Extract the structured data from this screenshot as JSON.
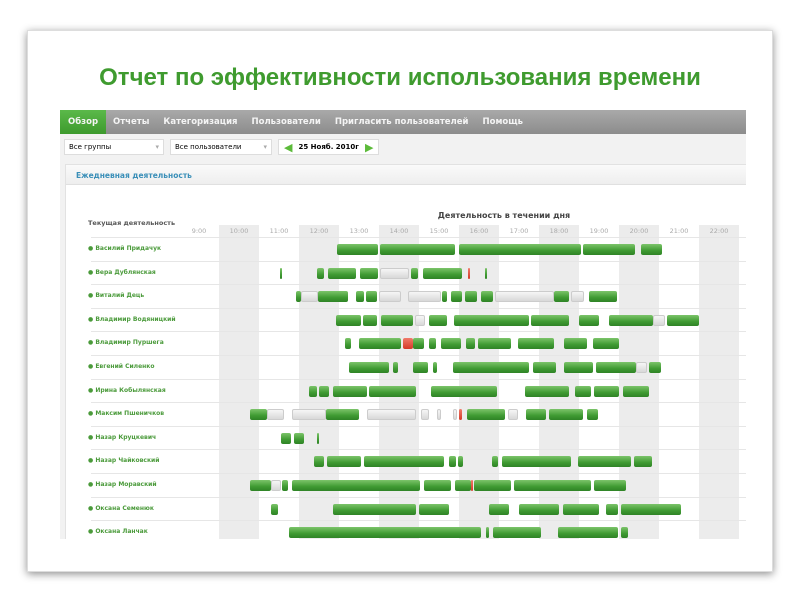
{
  "slide_title": "Отчет по эффективности использования времени",
  "nav": [
    {
      "label": "Обзор",
      "active": true
    },
    {
      "label": "Отчеты"
    },
    {
      "label": "Категоризация"
    },
    {
      "label": "Пользователи"
    },
    {
      "label": "Пригласить пользователей"
    },
    {
      "label": "Помощь"
    }
  ],
  "filters": {
    "group": "Все группы",
    "user": "Все пользователи",
    "date": "25 Нояб. 2010г"
  },
  "panel_title": "Ежедневная деятельность",
  "names_header": "Текущая деятельность",
  "chart_header": "Деятельность в течении дня",
  "colors": {
    "brand": "#3f9b2f",
    "active": "#3f9a32",
    "idle": "#d8d8d8",
    "alert": "#d43a28"
  },
  "hours": [
    "9:00",
    "10:00",
    "11:00",
    "12:00",
    "13:00",
    "14:00",
    "15:00",
    "16:00",
    "17:00",
    "18:00",
    "19:00",
    "20:00",
    "21:00",
    "22:00"
  ],
  "rows": [
    {
      "name": "Василий Придачук",
      "segments": [
        [
          12.45,
          13.48,
          "g"
        ],
        [
          13.53,
          15.4,
          "g"
        ],
        [
          15.5,
          18.55,
          "g"
        ],
        [
          18.6,
          19.9,
          "g"
        ],
        [
          20.05,
          20.58,
          "g"
        ]
      ]
    },
    {
      "name": "Вера Дублянская",
      "segments": [
        [
          11.03,
          11.08,
          "g"
        ],
        [
          11.95,
          12.13,
          "g"
        ],
        [
          12.23,
          12.93,
          "g"
        ],
        [
          13.03,
          13.48,
          "g"
        ],
        [
          13.53,
          14.25,
          "l"
        ],
        [
          14.3,
          14.48,
          "g"
        ],
        [
          14.6,
          15.58,
          "g"
        ],
        [
          15.73,
          15.78,
          "r"
        ],
        [
          16.15,
          16.2,
          "g"
        ]
      ]
    },
    {
      "name": "Виталий Дець",
      "segments": [
        [
          11.43,
          11.55,
          "g"
        ],
        [
          11.55,
          11.98,
          "l"
        ],
        [
          11.98,
          12.73,
          "g"
        ],
        [
          12.93,
          13.13,
          "g"
        ],
        [
          13.18,
          13.45,
          "g"
        ],
        [
          13.5,
          14.05,
          "l"
        ],
        [
          14.23,
          15.05,
          "l"
        ],
        [
          15.08,
          15.2,
          "g"
        ],
        [
          15.3,
          15.58,
          "g"
        ],
        [
          15.65,
          15.95,
          "g"
        ],
        [
          16.05,
          16.35,
          "g"
        ],
        [
          16.4,
          17.88,
          "l"
        ],
        [
          17.88,
          18.25,
          "g"
        ],
        [
          18.3,
          18.63,
          "l"
        ],
        [
          18.75,
          19.45,
          "g"
        ]
      ]
    },
    {
      "name": "Владимир Водяницкий",
      "segments": [
        [
          12.43,
          13.05,
          "g"
        ],
        [
          13.1,
          13.45,
          "g"
        ],
        [
          13.55,
          14.35,
          "g"
        ],
        [
          14.4,
          14.65,
          "l"
        ],
        [
          14.75,
          15.2,
          "g"
        ],
        [
          15.38,
          17.25,
          "g"
        ],
        [
          17.3,
          18.25,
          "g"
        ],
        [
          18.5,
          19.0,
          "g"
        ],
        [
          19.25,
          20.35,
          "g"
        ],
        [
          20.35,
          20.65,
          "l"
        ],
        [
          20.7,
          21.5,
          "g"
        ]
      ]
    },
    {
      "name": "Владимир Пуршега",
      "segments": [
        [
          12.65,
          12.8,
          "g"
        ],
        [
          13.0,
          14.05,
          "g"
        ],
        [
          14.1,
          14.35,
          "r"
        ],
        [
          14.35,
          14.63,
          "g"
        ],
        [
          14.75,
          14.93,
          "g"
        ],
        [
          15.05,
          15.55,
          "g"
        ],
        [
          15.68,
          15.9,
          "g"
        ],
        [
          15.98,
          16.8,
          "g"
        ],
        [
          16.98,
          17.88,
          "g"
        ],
        [
          18.13,
          18.7,
          "g"
        ],
        [
          18.85,
          19.5,
          "g"
        ]
      ]
    },
    {
      "name": "Евгений Силенко",
      "segments": [
        [
          12.75,
          13.75,
          "g"
        ],
        [
          13.85,
          13.98,
          "g"
        ],
        [
          14.35,
          14.73,
          "g"
        ],
        [
          14.85,
          14.95,
          "g"
        ],
        [
          15.35,
          17.25,
          "g"
        ],
        [
          17.35,
          17.93,
          "g"
        ],
        [
          18.13,
          18.85,
          "g"
        ],
        [
          18.93,
          19.93,
          "g"
        ],
        [
          19.93,
          20.2,
          "l"
        ],
        [
          20.25,
          20.55,
          "g"
        ]
      ]
    },
    {
      "name": "Ирина Кобылянская",
      "segments": [
        [
          11.75,
          11.95,
          "g"
        ],
        [
          12.0,
          12.25,
          "g"
        ],
        [
          12.35,
          13.2,
          "g"
        ],
        [
          13.25,
          14.43,
          "g"
        ],
        [
          14.8,
          16.45,
          "g"
        ],
        [
          17.15,
          18.25,
          "g"
        ],
        [
          18.4,
          18.8,
          "g"
        ],
        [
          18.88,
          19.5,
          "g"
        ],
        [
          19.6,
          20.25,
          "g"
        ]
      ]
    },
    {
      "name": "Максим Пшеничков",
      "segments": [
        [
          10.28,
          10.7,
          "g"
        ],
        [
          10.7,
          11.13,
          "l"
        ],
        [
          11.33,
          12.18,
          "l"
        ],
        [
          12.18,
          13.0,
          "g"
        ],
        [
          13.2,
          14.43,
          "l"
        ],
        [
          14.55,
          14.75,
          "l"
        ],
        [
          14.95,
          15.05,
          "l"
        ],
        [
          15.35,
          15.45,
          "l"
        ],
        [
          15.5,
          15.58,
          "r"
        ],
        [
          15.7,
          16.65,
          "g"
        ],
        [
          16.73,
          16.98,
          "l"
        ],
        [
          17.18,
          17.68,
          "g"
        ],
        [
          17.75,
          18.6,
          "g"
        ],
        [
          18.7,
          18.98,
          "g"
        ]
      ]
    },
    {
      "name": "Назар Круцкевич",
      "segments": [
        [
          11.05,
          11.3,
          "g"
        ],
        [
          11.38,
          11.63,
          "g"
        ],
        [
          11.95,
          11.98,
          "g"
        ]
      ]
    },
    {
      "name": "Назар Чайковский",
      "segments": [
        [
          11.88,
          12.13,
          "g"
        ],
        [
          12.2,
          13.05,
          "g"
        ],
        [
          13.13,
          15.13,
          "g"
        ],
        [
          15.25,
          15.43,
          "g"
        ],
        [
          15.48,
          15.6,
          "g"
        ],
        [
          16.33,
          16.48,
          "g"
        ],
        [
          16.58,
          18.3,
          "g"
        ],
        [
          18.48,
          19.8,
          "g"
        ],
        [
          19.88,
          20.33,
          "g"
        ]
      ]
    },
    {
      "name": "Назар Моравский",
      "segments": [
        [
          10.28,
          10.8,
          "g"
        ],
        [
          10.8,
          11.05,
          "l"
        ],
        [
          11.08,
          11.23,
          "g"
        ],
        [
          11.33,
          14.53,
          "g"
        ],
        [
          14.63,
          15.3,
          "g"
        ],
        [
          15.4,
          15.8,
          "g"
        ],
        [
          15.8,
          15.85,
          "r"
        ],
        [
          15.88,
          16.8,
          "g"
        ],
        [
          16.88,
          18.8,
          "g"
        ],
        [
          18.88,
          19.68,
          "g"
        ]
      ]
    },
    {
      "name": "Оксана Семенюк",
      "segments": [
        [
          10.8,
          10.98,
          "g"
        ],
        [
          12.35,
          14.43,
          "g"
        ],
        [
          14.5,
          15.25,
          "g"
        ],
        [
          16.25,
          16.75,
          "g"
        ],
        [
          17.0,
          18.0,
          "g"
        ],
        [
          18.1,
          19.0,
          "g"
        ],
        [
          19.18,
          19.48,
          "g"
        ],
        [
          19.55,
          21.05,
          "g"
        ]
      ]
    },
    {
      "name": "Оксана Ланчак",
      "segments": [
        [
          11.25,
          16.05,
          "g"
        ],
        [
          16.18,
          16.25,
          "g"
        ],
        [
          16.35,
          17.55,
          "g"
        ],
        [
          17.98,
          19.48,
          "g"
        ],
        [
          19.55,
          19.73,
          "g"
        ]
      ]
    }
  ]
}
